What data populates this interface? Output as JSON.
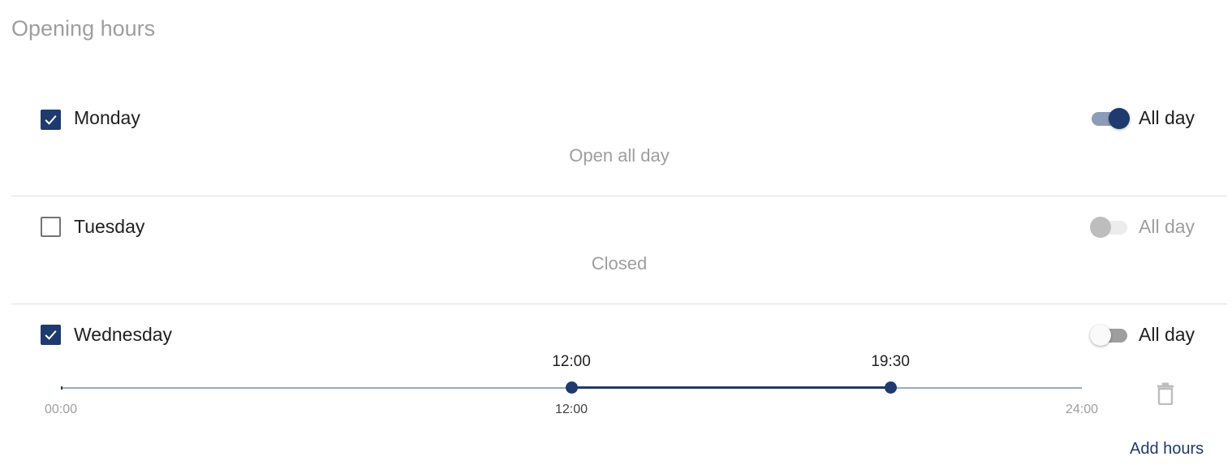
{
  "title": "Opening hours",
  "colors": {
    "accent": "#1e3a6e",
    "muted": "#9e9e9e",
    "divider": "#e0e0e0"
  },
  "days": [
    {
      "label": "Monday",
      "checked": true,
      "all_day_label": "All day",
      "all_day": true,
      "status": "Open all day"
    },
    {
      "label": "Tuesday",
      "checked": false,
      "all_day_label": "All day",
      "all_day": false,
      "status": "Closed"
    },
    {
      "label": "Wednesday",
      "checked": true,
      "all_day_label": "All day",
      "all_day": false,
      "range": {
        "start": "12:00",
        "end": "19:30",
        "start_fraction": 0.5,
        "end_fraction": 0.8125,
        "ticks": [
          "00:00",
          "12:00",
          "24:00"
        ]
      },
      "delete_icon": "trash-icon",
      "add_hours_label": "Add hours"
    }
  ]
}
